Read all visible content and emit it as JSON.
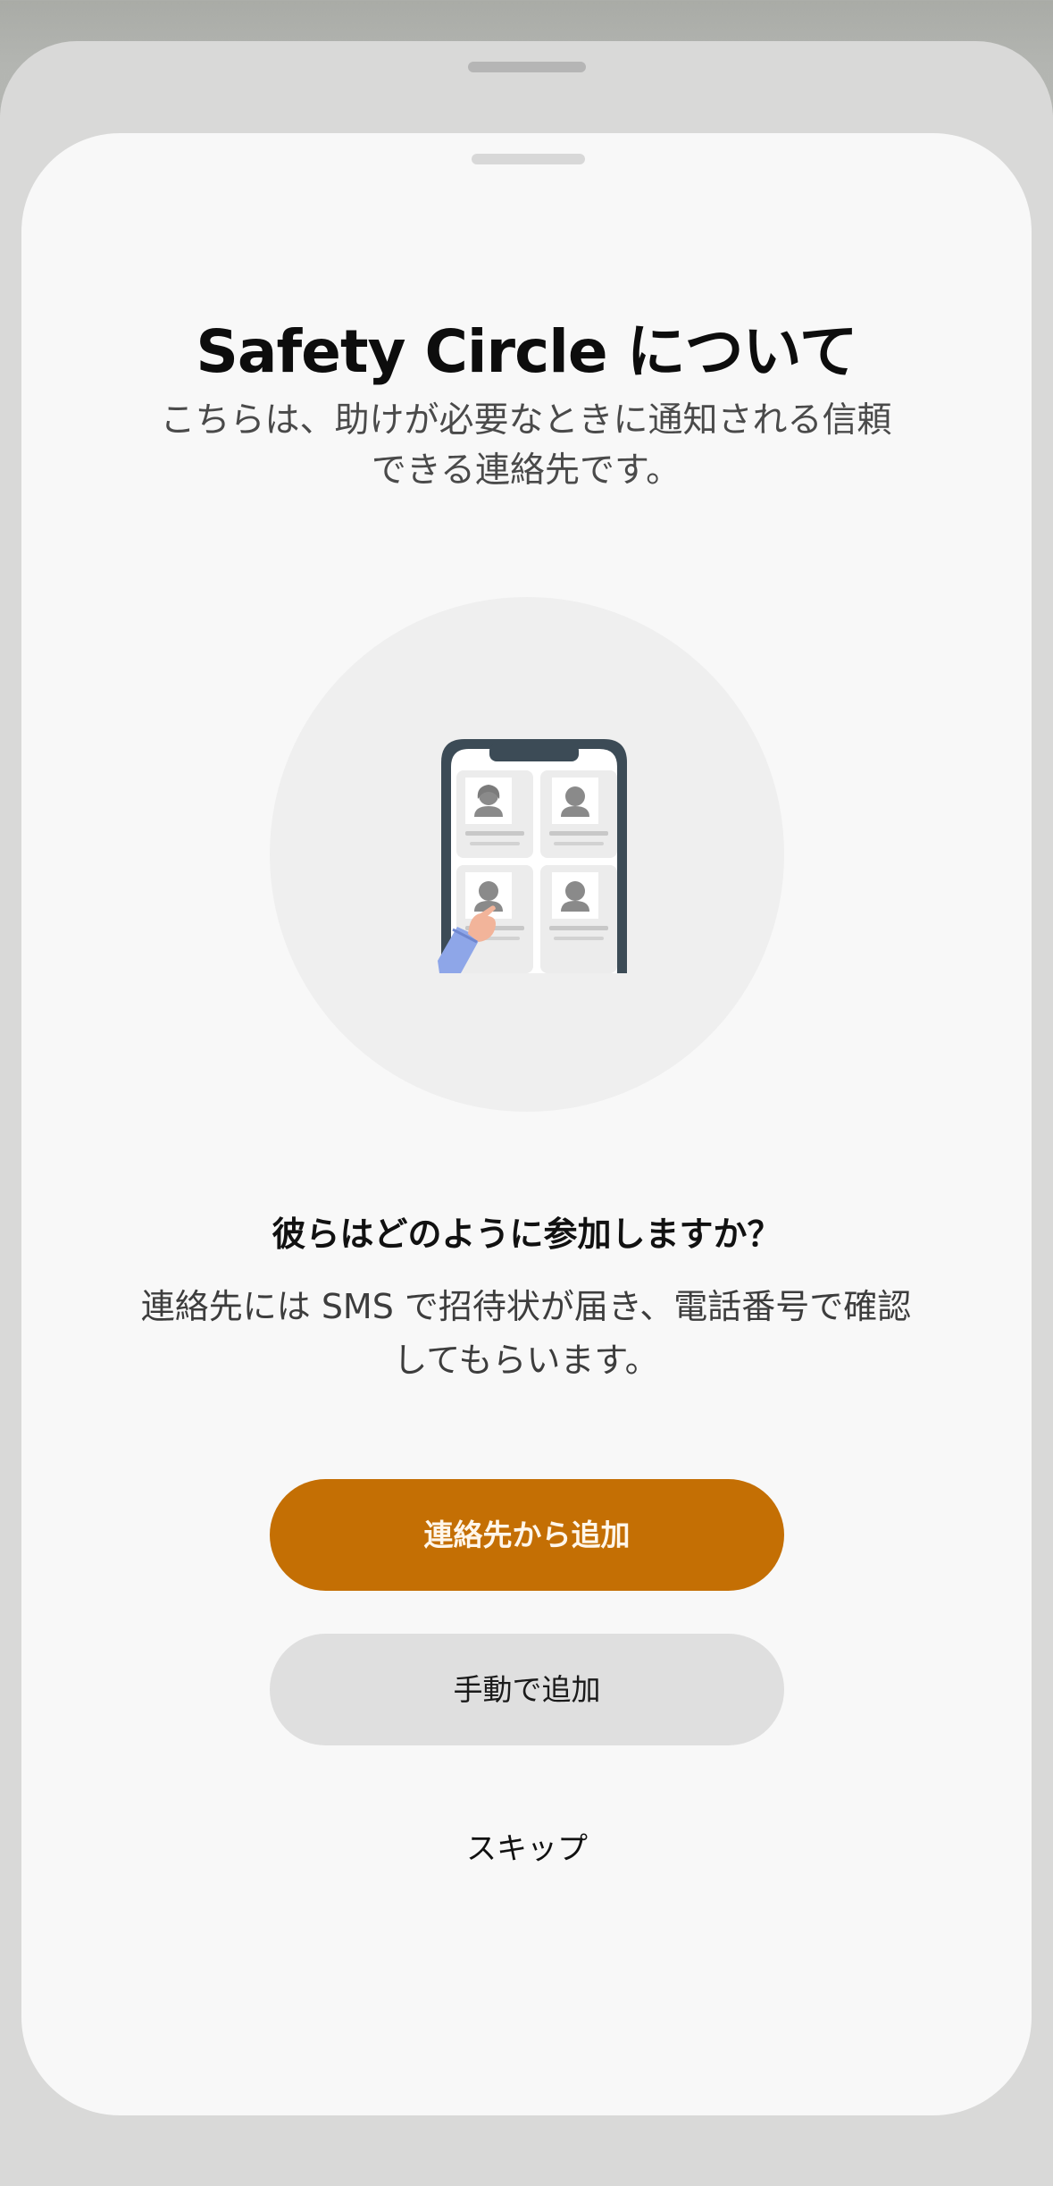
{
  "sheet": {
    "title": "Safety Circle について",
    "subtitle": "こちらは、助けが必要なときに通知される信頼できる連絡先です。",
    "illustration_icon": "phone-contacts-illustration",
    "question": "彼らはどのように参加しますか？",
    "description": "連絡先には SMS で招待状が届き、電話番号で確認してもらいます。",
    "primary_button": "連絡先から追加",
    "secondary_button": "手動で追加",
    "skip_link": "スキップ"
  },
  "colors": {
    "accent": "#c46f04",
    "secondary_button": "#dfdfdf",
    "sheet_background": "#f8f8f8"
  }
}
